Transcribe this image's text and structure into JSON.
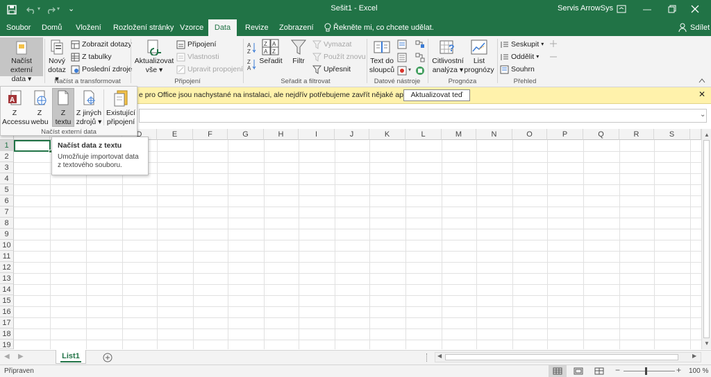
{
  "titlebar": {
    "title": "Sešit1  -  Excel",
    "user": "Servis ArrowSys",
    "qat_menu": "⌄"
  },
  "tabs": [
    {
      "label": "Soubor"
    },
    {
      "label": "Domů"
    },
    {
      "label": "Vložení"
    },
    {
      "label": "Rozložení stránky"
    },
    {
      "label": "Vzorce"
    },
    {
      "label": "Data"
    },
    {
      "label": "Revize"
    },
    {
      "label": "Zobrazení"
    }
  ],
  "tell_me": "Řekněte mi, co chcete udělat.",
  "share": "Sdílet",
  "ribbon": {
    "load_external_line1": "Načíst externí",
    "load_external_line2": "data",
    "new_query_line1": "Nový",
    "new_query_line2": "dotaz",
    "show_queries": "Zobrazit dotazy",
    "from_table": "Z tabulky",
    "recent_sources": "Poslední zdroje",
    "group_transform": "Načíst a transformovat",
    "refresh_all_line1": "Aktualizovat",
    "refresh_all_line2": "vše",
    "connections": "Připojení",
    "properties": "Vlastnosti",
    "edit_links": "Upravit propojení",
    "group_connections": "Připojení",
    "sort": "Seřadit",
    "filter": "Filtr",
    "clear": "Vymazat",
    "reapply": "Použít znovu",
    "advanced": "Upřesnit",
    "group_sort_filter": "Seřadit a filtrovat",
    "text_to_columns_line1": "Text do",
    "text_to_columns_line2": "sloupců",
    "group_data_tools": "Datové nástroje",
    "what_if_line1": "Citlivostní",
    "what_if_line2": "analýza",
    "forecast_line1": "List",
    "forecast_line2": "prognózy",
    "group_forecast": "Prognóza",
    "group_outline_btn": "Seskupit",
    "ungroup": "Oddělit",
    "subtotal": "Souhrn",
    "group_outline": "Přehled"
  },
  "message_bar": {
    "text": "e pro Office jsou nachystané na instalaci, ale nejdřív potřebujeme zavřít nějaké aplikace.",
    "button": "Aktualizovat teď"
  },
  "dropdown": {
    "items": [
      {
        "line1": "Z",
        "line2": "Accessu"
      },
      {
        "line1": "Z",
        "line2": "webu"
      },
      {
        "line1": "Z",
        "line2": "textu"
      },
      {
        "line1": "Z jiných",
        "line2": "zdrojů"
      },
      {
        "line1": "Existující",
        "line2": "připojení"
      }
    ],
    "group_label": "Načíst externí data"
  },
  "tooltip": {
    "title": "Načíst data z textu",
    "body": "Umožňuje importovat data z textového souboru."
  },
  "columns": [
    "D",
    "E",
    "F",
    "G",
    "H",
    "I",
    "J",
    "K",
    "L",
    "M",
    "N",
    "O",
    "P",
    "Q",
    "R",
    "S"
  ],
  "rows": [
    "1",
    "2",
    "3",
    "4",
    "5",
    "6",
    "7",
    "8",
    "9",
    "10",
    "11",
    "12",
    "13",
    "14",
    "15",
    "16",
    "17",
    "18",
    "19"
  ],
  "sheet_tab": "List1",
  "status": {
    "ready": "Připraven",
    "zoom": "100 %"
  },
  "colors": {
    "accent": "#217346",
    "message_bar": "#fff2ab"
  }
}
